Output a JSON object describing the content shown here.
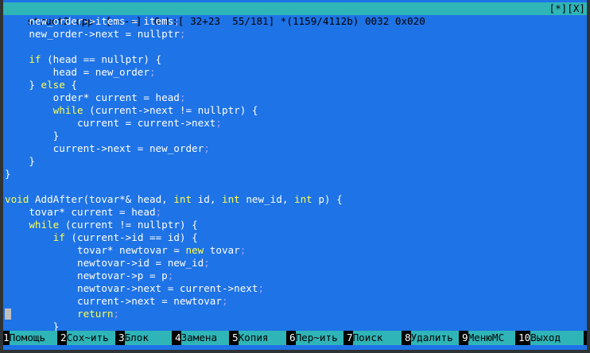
{
  "status": {
    "filename": "struct2.cpp",
    "info": "[----]  0 L:[ 32+23  55/181] *(1159/4112b) 0032 0x020",
    "right": "[*][X]"
  },
  "code_lines": [
    [
      {
        "t": "    new_order->items = items"
      },
      {
        "t": ";",
        "s": "semi"
      }
    ],
    [
      {
        "t": "    new_order->next = nullptr"
      },
      {
        "t": ";",
        "s": "semi"
      }
    ],
    [],
    [
      {
        "t": "    "
      },
      {
        "t": "if",
        "s": "kw"
      },
      {
        "t": " (head == nullptr) {"
      }
    ],
    [
      {
        "t": "        head = new_order"
      },
      {
        "t": ";",
        "s": "semi"
      }
    ],
    [
      {
        "t": "    } "
      },
      {
        "t": "else",
        "s": "kw"
      },
      {
        "t": " {"
      }
    ],
    [
      {
        "t": "        order* current = head"
      },
      {
        "t": ";",
        "s": "semi"
      }
    ],
    [
      {
        "t": "        "
      },
      {
        "t": "while",
        "s": "kw"
      },
      {
        "t": " (current->next != nullptr) {"
      }
    ],
    [
      {
        "t": "            current = current->next"
      },
      {
        "t": ";",
        "s": "semi"
      }
    ],
    [
      {
        "t": "        }"
      }
    ],
    [
      {
        "t": "        current->next = new_order"
      },
      {
        "t": ";",
        "s": "semi"
      }
    ],
    [
      {
        "t": "    }"
      }
    ],
    [
      {
        "t": "}"
      }
    ],
    [],
    [
      {
        "t": "void",
        "s": "kw"
      },
      {
        "t": " AddAfter(tovar*& head, "
      },
      {
        "t": "int",
        "s": "kw"
      },
      {
        "t": " id, "
      },
      {
        "t": "int",
        "s": "kw"
      },
      {
        "t": " new_id, "
      },
      {
        "t": "int",
        "s": "kw"
      },
      {
        "t": " p) {"
      }
    ],
    [
      {
        "t": "    tovar* current = head"
      },
      {
        "t": ";",
        "s": "semi"
      }
    ],
    [
      {
        "t": "    "
      },
      {
        "t": "while",
        "s": "kw"
      },
      {
        "t": " (current != nullptr) {"
      }
    ],
    [
      {
        "t": "        "
      },
      {
        "t": "if",
        "s": "kw"
      },
      {
        "t": " (current->id == id) {"
      }
    ],
    [
      {
        "t": "            tovar* newtovar = "
      },
      {
        "t": "new",
        "s": "kw"
      },
      {
        "t": " tovar"
      },
      {
        "t": ";",
        "s": "semi"
      }
    ],
    [
      {
        "t": "            newtovar->id = new_id"
      },
      {
        "t": ";",
        "s": "semi"
      }
    ],
    [
      {
        "t": "            newtovar->p = p"
      },
      {
        "t": ";",
        "s": "semi"
      }
    ],
    [
      {
        "t": "            newtovar->next = current->next"
      },
      {
        "t": ";",
        "s": "semi"
      }
    ],
    [
      {
        "t": "            current->next = newtovar"
      },
      {
        "t": ";",
        "s": "semi"
      }
    ],
    [
      {
        "t": "            "
      },
      {
        "t": "return",
        "s": "kw"
      },
      {
        "t": ";",
        "s": "semi"
      }
    ],
    [
      {
        "t": "        }"
      }
    ]
  ],
  "cursor_line": 23,
  "fkeys": [
    {
      "num": "1",
      "label": "Помощь"
    },
    {
      "num": "2",
      "label": "Сох~ить"
    },
    {
      "num": "3",
      "label": "Блок"
    },
    {
      "num": "4",
      "label": "Замена"
    },
    {
      "num": "5",
      "label": "Копия"
    },
    {
      "num": "6",
      "label": "Пер~ить"
    },
    {
      "num": "7",
      "label": "Поиск"
    },
    {
      "num": "8",
      "label": "Удалить"
    },
    {
      "num": "9",
      "label": "МенюMC"
    },
    {
      "num": "10",
      "label": "Выход"
    }
  ]
}
